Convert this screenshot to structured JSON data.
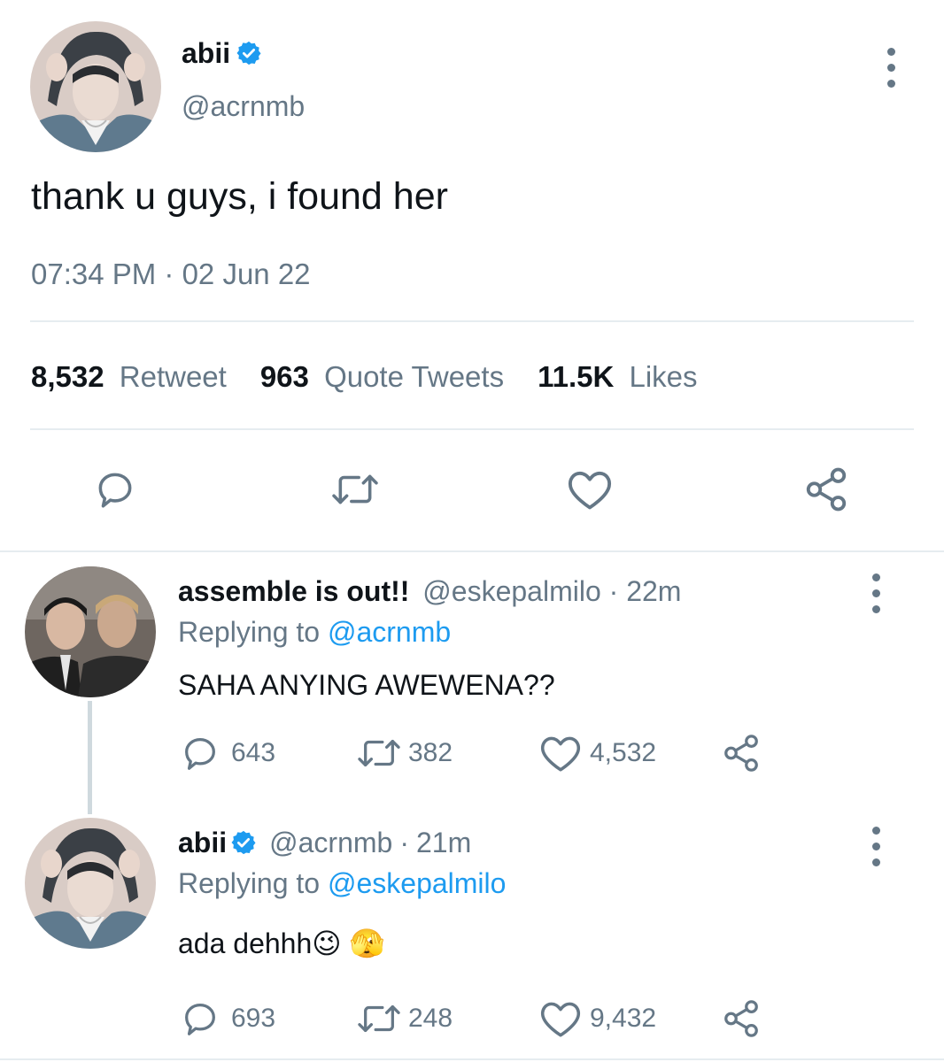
{
  "main_tweet": {
    "display_name": "abii",
    "handle": "@acrnmb",
    "text": "thank u guys, i found her",
    "timestamp": "07:34 PM · 02 Jun 22",
    "stats": {
      "retweets_count": "8,532",
      "retweets_label": "Retweet",
      "quotes_count": "963",
      "quotes_label": "Quote Tweets",
      "likes_count": "11.5K",
      "likes_label": "Likes"
    }
  },
  "replies": [
    {
      "display_name": "assemble is out!!",
      "handle": "@eskepalmilo",
      "time": "22m",
      "replying_prefix": "Replying to",
      "replying_to": "@acrnmb",
      "text": "SAHA ANYING AWEWENA??",
      "reply_count": "643",
      "retweet_count": "382",
      "like_count": "4,532"
    },
    {
      "display_name": "abii",
      "handle": "@acrnmb",
      "time": "21m",
      "replying_prefix": "Replying to",
      "replying_to": "@eskepalmilo",
      "text": "ada dehhh😉 🫣",
      "reply_count": "693",
      "retweet_count": "248",
      "like_count": "9,432"
    }
  ],
  "colors": {
    "accent": "#1d9bf0",
    "secondary_text": "#657786",
    "divider": "#e6ecf0"
  }
}
